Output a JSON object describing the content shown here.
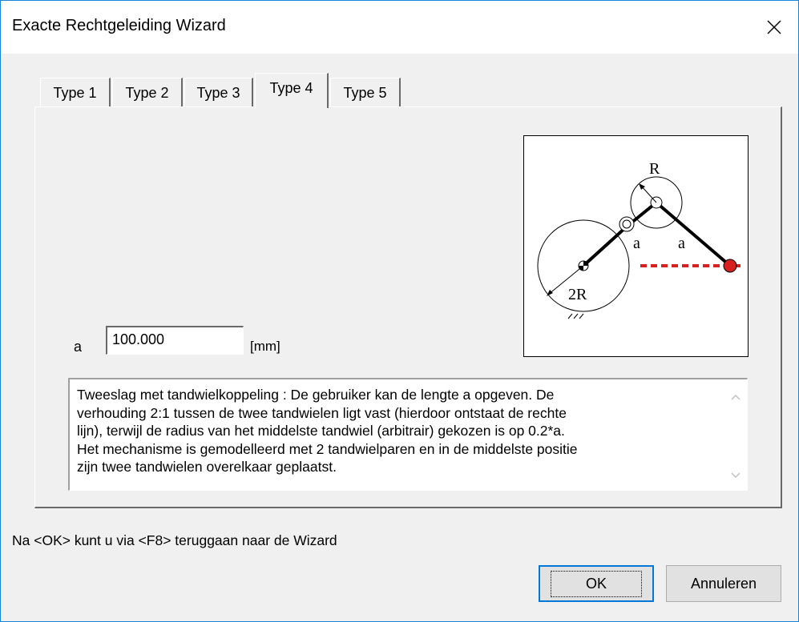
{
  "window": {
    "title": "Exacte Rechtgeleiding Wizard"
  },
  "tabs": [
    {
      "label": "Type 1"
    },
    {
      "label": "Type 2"
    },
    {
      "label": "Type 3"
    },
    {
      "label": "Type 4"
    },
    {
      "label": "Type 5"
    }
  ],
  "active_tab": "Type 4",
  "diagram": {
    "labels": {
      "r": "R",
      "two_r": "2R",
      "a_left": "a",
      "a_right": "a"
    }
  },
  "field_a": {
    "label": "a",
    "value": "100.000",
    "unit": "[mm]"
  },
  "description": "Tweeslag met tandwielkoppeling : De gebruiker kan de lengte a opgeven. De\nverhouding 2:1 tussen de twee tandwielen ligt vast (hierdoor ontstaat de rechte\nlijn), terwijl de radius van het middelste tandwiel (arbitrair) gekozen is op 0.2*a.\nHet mechanisme is gemodelleerd met 2 tandwielparen en in de middelste positie\nzijn twee tandwielen overelkaar geplaatst.",
  "hint": "Na <OK> kunt u via <F8> teruggaan naar de Wizard",
  "buttons": {
    "ok": "OK",
    "cancel": "Annuleren"
  },
  "colors": {
    "accent": "#0078d7",
    "trace_red": "#d72020"
  }
}
